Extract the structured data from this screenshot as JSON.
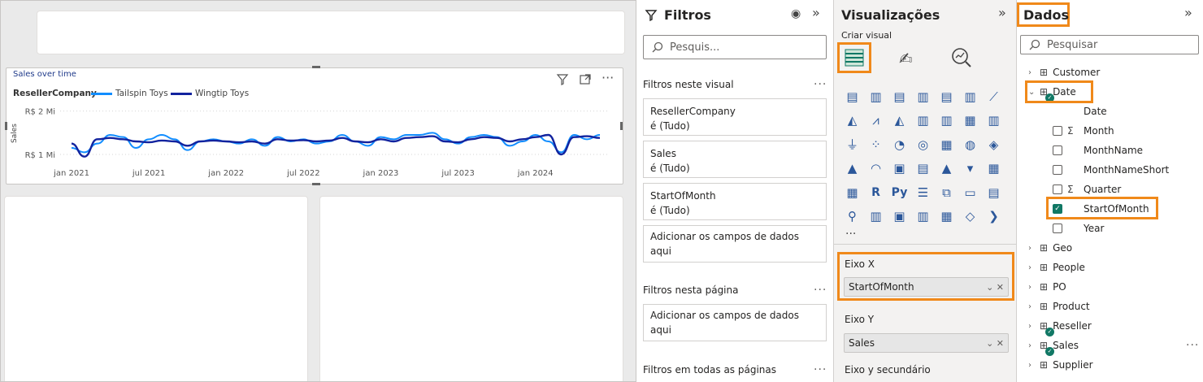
{
  "chart": {
    "title": "Sales over time",
    "legend_title": "ResellerCompany",
    "y_axis_label": "Sales",
    "y_ticks": [
      "R$ 2 Mi",
      "R$ 1 Mi"
    ],
    "x_ticks": [
      "jan 2021",
      "jul 2021",
      "jan 2022",
      "jul 2022",
      "jan 2023",
      "jul 2023",
      "jan 2024"
    ]
  },
  "chart_data": {
    "type": "line",
    "title": "Sales over time",
    "xlabel": "",
    "ylabel": "Sales",
    "ylim": [
      0.85,
      2.05
    ],
    "x": [
      "2021-01",
      "2021-02",
      "2021-03",
      "2021-04",
      "2021-05",
      "2021-06",
      "2021-07",
      "2021-08",
      "2021-09",
      "2021-10",
      "2021-11",
      "2021-12",
      "2022-01",
      "2022-02",
      "2022-03",
      "2022-04",
      "2022-05",
      "2022-06",
      "2022-07",
      "2022-08",
      "2022-09",
      "2022-10",
      "2022-11",
      "2022-12",
      "2023-01",
      "2023-02",
      "2023-03",
      "2023-04",
      "2023-05",
      "2023-06",
      "2023-07",
      "2023-08",
      "2023-09",
      "2023-10",
      "2023-11",
      "2023-12",
      "2024-01",
      "2024-02",
      "2024-03",
      "2024-04",
      "2024-05",
      "2024-06"
    ],
    "series": [
      {
        "name": "Tailspin Toys",
        "color": "#118dff",
        "values": [
          1.15,
          1.05,
          1.25,
          1.45,
          1.4,
          1.15,
          1.35,
          1.45,
          1.35,
          1.1,
          1.3,
          1.35,
          1.3,
          1.25,
          1.35,
          1.2,
          1.4,
          1.3,
          1.35,
          1.25,
          1.3,
          1.45,
          1.3,
          1.2,
          1.4,
          1.35,
          1.45,
          1.45,
          1.5,
          1.35,
          1.25,
          1.4,
          1.45,
          1.4,
          1.2,
          1.3,
          1.45,
          1.3,
          1.05,
          1.45,
          1.35,
          1.45
        ]
      },
      {
        "name": "Wingtip Toys",
        "color": "#12239e",
        "values": [
          1.25,
          0.95,
          1.35,
          1.38,
          1.35,
          1.3,
          1.28,
          1.32,
          1.3,
          1.2,
          1.3,
          1.32,
          1.3,
          1.28,
          1.3,
          1.25,
          1.35,
          1.32,
          1.33,
          1.3,
          1.32,
          1.38,
          1.3,
          1.28,
          1.35,
          1.3,
          1.38,
          1.4,
          1.42,
          1.3,
          1.28,
          1.35,
          1.4,
          1.38,
          1.3,
          1.35,
          1.4,
          1.45,
          1.0,
          1.4,
          1.42,
          1.38
        ]
      }
    ]
  },
  "filters": {
    "title": "Filtros",
    "search_placeholder": "Pesquis...",
    "section_visual": "Filtros neste visual",
    "cards": [
      {
        "field": "ResellerCompany",
        "state": "é (Tudo)"
      },
      {
        "field": "Sales",
        "state": "é (Tudo)"
      },
      {
        "field": "StartOfMonth",
        "state": "é (Tudo)"
      }
    ],
    "drop_visual": "Adicionar os campos de dados aqui",
    "section_page": "Filtros nesta página",
    "drop_page": "Adicionar os campos de dados aqui",
    "section_all": "Filtros em todas as páginas"
  },
  "viz": {
    "title": "Visualizações",
    "subtitle": "Criar visual",
    "more": "···",
    "wells": [
      {
        "label": "Eixo X",
        "value": "StartOfMonth"
      },
      {
        "label": "Eixo Y",
        "value": "Sales"
      },
      {
        "label": "Eixo y secundário",
        "value": ""
      }
    ]
  },
  "data": {
    "title": "Dados",
    "search_placeholder": "Pesquisar",
    "tables": [
      {
        "name": "Customer",
        "expanded": false,
        "badge": false
      },
      {
        "name": "Date",
        "expanded": true,
        "badge": true
      },
      {
        "name": "Geo",
        "expanded": false,
        "badge": false
      },
      {
        "name": "People",
        "expanded": false,
        "badge": false
      },
      {
        "name": "PO",
        "expanded": false,
        "badge": false
      },
      {
        "name": "Product",
        "expanded": false,
        "badge": false
      },
      {
        "name": "Reseller",
        "expanded": false,
        "badge": true
      },
      {
        "name": "Sales",
        "expanded": false,
        "badge": true
      },
      {
        "name": "Supplier",
        "expanded": false,
        "badge": false
      }
    ],
    "date_fields": [
      {
        "name": "Date",
        "sigma": false,
        "checked": false,
        "checkbox": false
      },
      {
        "name": "Month",
        "sigma": true,
        "checked": false,
        "checkbox": true
      },
      {
        "name": "MonthName",
        "sigma": false,
        "checked": false,
        "checkbox": true
      },
      {
        "name": "MonthNameShort",
        "sigma": false,
        "checked": false,
        "checkbox": true
      },
      {
        "name": "Quarter",
        "sigma": true,
        "checked": false,
        "checkbox": true
      },
      {
        "name": "StartOfMonth",
        "sigma": false,
        "checked": true,
        "checkbox": true
      },
      {
        "name": "Year",
        "sigma": false,
        "checked": false,
        "checkbox": true
      }
    ]
  }
}
